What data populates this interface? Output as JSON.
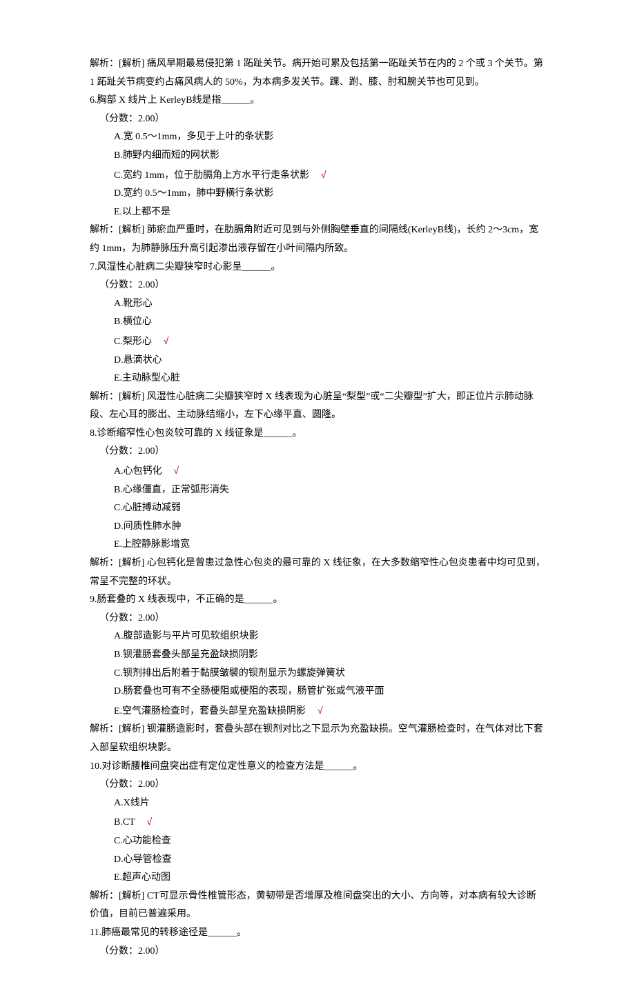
{
  "pre": {
    "a1": "解析：[解析] 痛风早期最易侵犯第 1 跖趾关节。病开始可累及包括第一跖趾关节在内的 2 个或 3 个关节。第 1 跖趾关节病变约占痛风病人的 50%，为本病多发关节。踝、跗、膝、肘和腕关节也可见到。"
  },
  "q6": {
    "stem": "6.胸部 X 线片上 KerleyB线是指______。",
    "score": "（分数：2.00）",
    "A": "A.宽 0.5～1mm，多见于上叶的条状影",
    "B": "B.肺野内细而短的网状影",
    "C": "C.宽约 1mm，位于肋膈角上方水平行走条状影",
    "D": "D.宽约 0.5～1mm，肺中野横行条状影",
    "E": "E.以上都不是",
    "ans": "解析：[解析] 肺瘀血严重时，在肋膈角附近可见到与外侧胸壁垂直的间隔线(KerleyB线)，长约 2～3cm，宽约 1mm，为肺静脉压升高引起渗出液存留在小叶间隔内所致。"
  },
  "q7": {
    "stem": "7.风湿性心脏病二尖瓣狭窄时心影呈______。",
    "score": "（分数：2.00）",
    "A": "A.靴形心",
    "B": "B.横位心",
    "C": "C.梨形心",
    "D": "D.悬滴状心",
    "E": "E.主动脉型心脏",
    "ans": "解析：[解析] 风湿性心脏病二尖瓣狭窄时 X 线表现为心脏呈“梨型”或“二尖瓣型”扩大，即正位片示肺动脉段、左心耳的膨出、主动脉结缩小，左下心缘平直、圆隆。"
  },
  "q8": {
    "stem": "8.诊断缩窄性心包炎较可靠的 X 线征象是______。",
    "score": "（分数：2.00）",
    "A": "A.心包钙化",
    "B": "B.心缘僵直，正常弧形消失",
    "C": "C.心脏搏动减弱",
    "D": "D.间质性肺水肿",
    "E": "E.上腔静脉影增宽",
    "ans": "解析：[解析] 心包钙化是曾患过急性心包炎的最可靠的 X 线征象，在大多数缩窄性心包炎患者中均可见到，常呈不完整的环状。"
  },
  "q9": {
    "stem": "9.肠套叠的 X 线表现中，不正确的是______。",
    "score": "（分数：2.00）",
    "A": "A.腹部造影与平片可见软组织块影",
    "B": "B.钡灌肠套叠头部呈充盈缺损阴影",
    "C": "C.钡剂排出后附着于黏膜皱襞的钡剂显示为螺旋弹簧状",
    "D": "D.肠套叠也可有不全肠梗阻或梗阻的表现，肠管扩张或气液平面",
    "E": "E.空气灌肠检查时，套叠头部呈充盈缺损阴影",
    "ans": "解析：[解析] 钡灌肠造影时，套叠头部在钡剂对比之下显示为充盈缺损。空气灌肠检查时，在气体对比下套入部呈软组织块影。"
  },
  "q10": {
    "stem": "10.对诊断腰椎间盘突出症有定位定性意义的检查方法是______。",
    "score": "（分数：2.00）",
    "A": "A.X线片",
    "B": "B.CT",
    "C": "C.心功能检查",
    "D": "D.心导管检查",
    "E": "E.超声心动图",
    "ans": "解析：[解析] CT可显示骨性椎管形态，黄韧带是否增厚及椎间盘突出的大小、方向等，对本病有较大诊断价值，目前已普遍采用。"
  },
  "q11": {
    "stem": "11.肺癌最常见的转移途径是______。",
    "score": "（分数：2.00）"
  },
  "check": "√"
}
